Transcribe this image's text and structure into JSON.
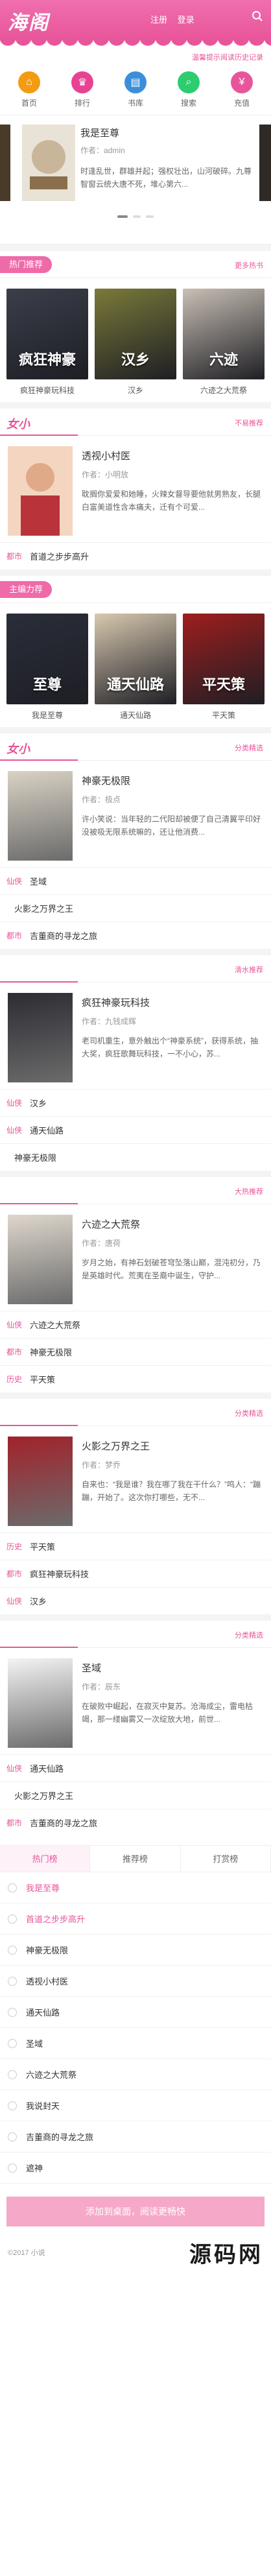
{
  "header": {
    "logo": "海阁",
    "links": [
      "注册",
      "登录"
    ],
    "hint": "温馨提示阅读历史记录"
  },
  "nav": [
    {
      "label": "首页",
      "icon": "home-icon",
      "color": "#f39c12"
    },
    {
      "label": "排行",
      "icon": "ranking-icon",
      "color": "#e84393"
    },
    {
      "label": "书库",
      "icon": "library-icon",
      "color": "#3b8fd9"
    },
    {
      "label": "搜索",
      "icon": "search-icon",
      "color": "#2ecc71"
    },
    {
      "label": "充值",
      "icon": "recharge-icon",
      "color": "#e8559a"
    }
  ],
  "featured": {
    "title": "我是至尊",
    "author": "作者：admin",
    "desc": "时逢乱世，群雄并起；强权壮出，山河破碎。九尊智窗云统大唐不死，堆心第六..."
  },
  "hot": {
    "tab": "热门推荐",
    "more": "更多热书",
    "items": [
      {
        "title": "疯狂神豪玩科技",
        "cover": "疯狂神豪",
        "color": "#3a3f4a"
      },
      {
        "title": "汉乡",
        "cover": "汉乡",
        "color": "#7a7a3a"
      },
      {
        "title": "六迹之大荒祭",
        "cover": "六迹",
        "color": "#c9c0b5"
      }
    ]
  },
  "female1": {
    "label": "女小",
    "more": "不易推荐",
    "book": {
      "title": "透视小村医",
      "author": "作者：小明放",
      "desc": "耽搁你爱爱和她睡，火辣女督导要他就男熟友，长腿白富美道性含本痛夫，迁有个可爱..."
    },
    "row": {
      "tag": "都市",
      "text": "首道之步步高升"
    }
  },
  "hot2": {
    "tab": "主编力荐",
    "items": [
      {
        "title": "我是至尊",
        "cover": "至尊",
        "color": "#2a2e3a"
      },
      {
        "title": "通天仙路",
        "cover": "通天仙路",
        "color": "#d8c9b0"
      },
      {
        "title": "平天策",
        "cover": "平天策",
        "color": "#9e1e1e"
      }
    ]
  },
  "female2": {
    "label": "女小",
    "more": "分类精选",
    "book": {
      "title": "神豪无极限",
      "author": "作者：极点",
      "desc": "许小笑说：当年轻的二代阳却被便了自己清翼平印好没被吸无限系统嘛的，还让他消费..."
    },
    "rows": [
      {
        "tag": "仙侠",
        "text": "圣域"
      },
      {
        "tag": "",
        "text": "火影之万界之王"
      },
      {
        "tag": "都市",
        "text": "吉董商的寻龙之旅"
      }
    ]
  },
  "sec3": {
    "more": "清水推荐",
    "book": {
      "title": "疯狂神豪玩科技",
      "author": "作者：九钱成辉",
      "desc": "老司机重生，意外触出个“神豪系统”，获得系统，抽大奖，疯狂歌舞玩科技，一不小心，苏..."
    },
    "rows": [
      {
        "tag": "仙侠",
        "text": "汉乡"
      },
      {
        "tag": "仙侠",
        "text": "通天仙路"
      },
      {
        "tag": "",
        "text": "神豪无极限"
      }
    ]
  },
  "sec4": {
    "more": "大热推荐",
    "book": {
      "title": "六迹之大荒祭",
      "author": "作者：唐荷",
      "desc": "岁月之始，有神石划破苍穹坠落山巅，混沌初分，乃是英雄时代。荒夷在圣裔中诞生，守护..."
    },
    "rows": [
      {
        "tag": "仙侠",
        "text": "六迹之大荒祭"
      },
      {
        "tag": "都市",
        "text": "神豪无极限"
      },
      {
        "tag": "历史",
        "text": "平天策"
      }
    ]
  },
  "sec5": {
    "more": "分类精选",
    "book": {
      "title": "火影之万界之王",
      "author": "作者：梦乔",
      "desc": "自来也：“我是谁？我在哪了我在干什么？”鸣人：“蹦蹦，开始了。这次你打哪些，无不..."
    },
    "rows": [
      {
        "tag": "历史",
        "text": "平天策"
      },
      {
        "tag": "都市",
        "text": "疯狂神豪玩科技"
      },
      {
        "tag": "仙侠",
        "text": "汉乡"
      }
    ]
  },
  "sec6": {
    "more": "分类精选",
    "book": {
      "title": "圣域",
      "author": "作者：辰东",
      "desc": "在破败中崛起，在寂灭中复苏。沧海成尘，雷电枯竭，那一缕幽雾又一次绽放大地，前世..."
    },
    "rows": [
      {
        "tag": "仙侠",
        "text": "通天仙路"
      },
      {
        "tag": "",
        "text": "火影之万界之王"
      },
      {
        "tag": "都市",
        "text": "吉董商的寻龙之旅"
      }
    ]
  },
  "rank": {
    "tabs": [
      "热门榜",
      "推荐榜",
      "打赏榜"
    ],
    "rows": [
      {
        "text": "我是至尊",
        "hl": true
      },
      {
        "text": "首道之步步高升",
        "hl": true
      },
      {
        "text": "神豪无极限",
        "hl": false
      },
      {
        "text": "透视小村医",
        "hl": false
      },
      {
        "text": "通天仙路",
        "hl": false
      },
      {
        "text": "圣域",
        "hl": false
      },
      {
        "text": "六迹之大荒祭",
        "hl": false
      },
      {
        "text": "我说封天",
        "hl": false
      },
      {
        "text": "吉董商的寻龙之旅",
        "hl": false
      },
      {
        "text": "遮神",
        "hl": false
      }
    ]
  },
  "cta": "添加到桌面，阅读更畅快",
  "footer": {
    "copy": "©2017 小说",
    "watermark": "源码网"
  }
}
